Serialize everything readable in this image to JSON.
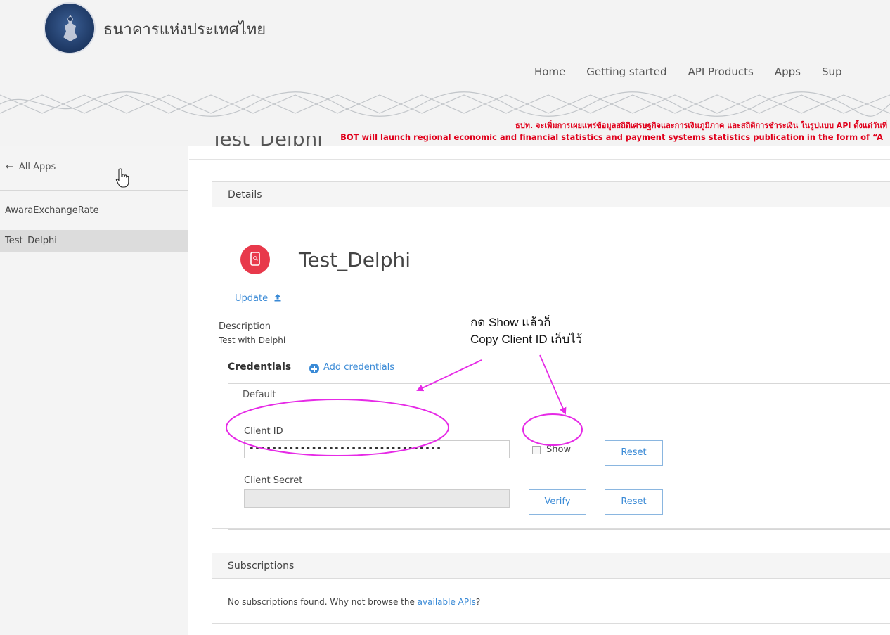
{
  "header": {
    "brand": "ธนาคารแห่งประเทศไทย",
    "nav": [
      "Home",
      "Getting started",
      "API Products",
      "Apps",
      "Sup"
    ],
    "notice_th": "ธปท. จะเพิ่มการเผยแพร่ข้อมูลสถิติเศรษฐกิจและการเงินภูมิภาค และสถิติการชำระเงิน ในรูปแบบ API ตั้งแต่วันที่",
    "notice_en": "BOT will launch regional economic and financial statistics and payment systems statistics publication in the form of “A"
  },
  "sidebar": {
    "back_label": "All Apps",
    "items": [
      "AwaraExchangeRate",
      "Test_Delphi"
    ],
    "active_index": 1
  },
  "page": {
    "title": "Test_Delphi"
  },
  "details": {
    "heading": "Details",
    "app_name": "Test_Delphi",
    "update_label": "Update",
    "description_label": "Description",
    "description_value": "Test with Delphi",
    "credentials_label": "Credentials",
    "add_credentials_label": "Add credentials",
    "credential_set": {
      "heading": "Default",
      "client_id_label": "Client ID",
      "client_id_value": "••••••••••••••••••••••••••••••••••",
      "show_label": "Show",
      "show_checked": false,
      "reset_label": "Reset",
      "client_secret_label": "Client Secret",
      "verify_label": "Verify",
      "reset2_label": "Reset"
    }
  },
  "subscriptions": {
    "heading": "Subscriptions",
    "text_before": "No subscriptions found. Why not browse the ",
    "link_text": "available APIs",
    "text_after": "?"
  },
  "annotation": {
    "line1": "กด Show แล้วก็",
    "line2": "Copy Client ID เก็บไว้",
    "color": "#e62ae6"
  },
  "colors": {
    "link": "#3a8ad6",
    "notice": "#e0001b",
    "app_icon": "#e8394b"
  }
}
